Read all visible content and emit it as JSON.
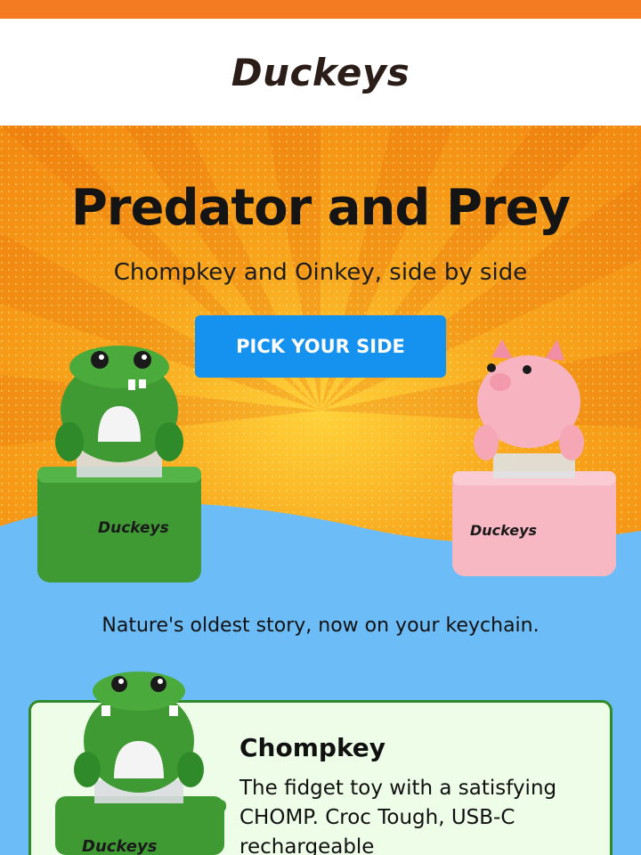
{
  "brand": {
    "logo_text": "Duckeys"
  },
  "colors": {
    "top_strip": "#f47b22",
    "hero_orange": "#f6a21c",
    "sky_blue": "#6cbcf7",
    "cta_blue": "#1591f0",
    "croc_green": "#3f9a34",
    "pig_pink": "#f7b8c4",
    "card_bg": "#eefde8",
    "card_border": "#2f8b2a"
  },
  "hero": {
    "title": "Predator and Prey",
    "subtitle": "Chompkey and Oinkey, side by side",
    "cta_label": "PICK YOUR SIDE",
    "left_toy": {
      "label": "Duckeys",
      "icon": "croc-keychain-icon"
    },
    "right_toy": {
      "label": "Duckeys",
      "icon": "pig-keychain-icon"
    }
  },
  "tagline": "Nature's oldest story, now on your keychain.",
  "product_card": {
    "title": "Chompkey",
    "description": "The fidget toy with a satisfying CHOMP. Croc Tough, USB-C rechargeable",
    "image_label": "Duckeys",
    "icon": "croc-keychain-icon"
  }
}
